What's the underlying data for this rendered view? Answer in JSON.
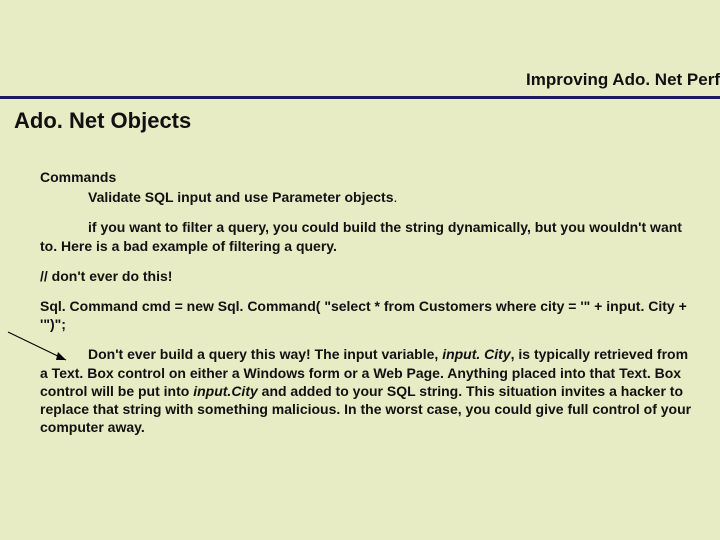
{
  "header": {
    "right_label": "Improving Ado. Net Perf"
  },
  "title": "Ado. Net Objects",
  "commands": {
    "heading": "Commands",
    "point_prefix": "Validate SQL input and use Parameter objects",
    "point_suffix": ".",
    "p1_a": "if you want to filter a query, you could build the string dynamically, but you wouldn't want to.  Here is a bad example of filtering a query.",
    "warn": "// don't ever do this!",
    "code": "Sql. Command cmd = new Sql. Command( \"select * from Customers where city = '\" + input. City + '\")\";",
    "p2_a": "Don't ever build a query this way!  The input variable, ",
    "p2_var": "input. City",
    "p2_b": ", is typically retrieved from a Text. Box control on either a Windows form or a Web Page. Anything placed into that Text. Box control will be put into ",
    "p2_var2": "input.City",
    "p2_c": " and added to your SQL string.  This situation invites a hacker to replace that string with something malicious.  In the worst case, you could give full control of your computer away."
  }
}
